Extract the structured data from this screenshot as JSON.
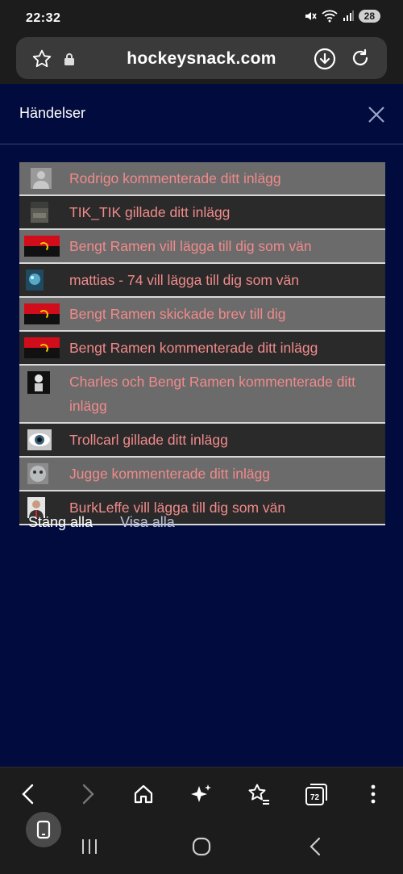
{
  "status": {
    "time": "22:32",
    "battery": "28"
  },
  "browser": {
    "url": "hockeysnack.com"
  },
  "panel": {
    "title": "Händelser",
    "notifications": [
      {
        "text": "Rodrigo kommenterade ditt inlägg",
        "avatar": "grey-person-avatar",
        "shade": "light"
      },
      {
        "text": "TIK_TIK gillade ditt inlägg",
        "avatar": "photo-avatar",
        "shade": "dark"
      },
      {
        "text": "Bengt Ramen vill lägga till dig som vän",
        "avatar": "angola-flag-avatar",
        "shade": "light"
      },
      {
        "text": "mattias - 74 vill lägga till dig som vän",
        "avatar": "blue-photo-avatar",
        "shade": "dark"
      },
      {
        "text": "Bengt Ramen skickade brev till dig",
        "avatar": "angola-flag-avatar",
        "shade": "light"
      },
      {
        "text": "Bengt Ramen kommenterade ditt inlägg",
        "avatar": "angola-flag-avatar",
        "shade": "dark"
      },
      {
        "text": "Charles och Bengt Ramen kommenterade ditt inlägg",
        "avatar": "skeleton-avatar",
        "shade": "light"
      },
      {
        "text": "Trollcarl gillade ditt inlägg",
        "avatar": "eye-avatar",
        "shade": "dark"
      },
      {
        "text": "Jugge kommenterade ditt inlägg",
        "avatar": "cat-avatar",
        "shade": "light"
      },
      {
        "text": "BurkLeffe vill lägga till dig som vän",
        "avatar": "man-portrait-avatar",
        "shade": "dark"
      }
    ],
    "close_all": "Stäng alla",
    "show_all": "Visa alla"
  },
  "nav": {
    "tabs_count": "72"
  }
}
